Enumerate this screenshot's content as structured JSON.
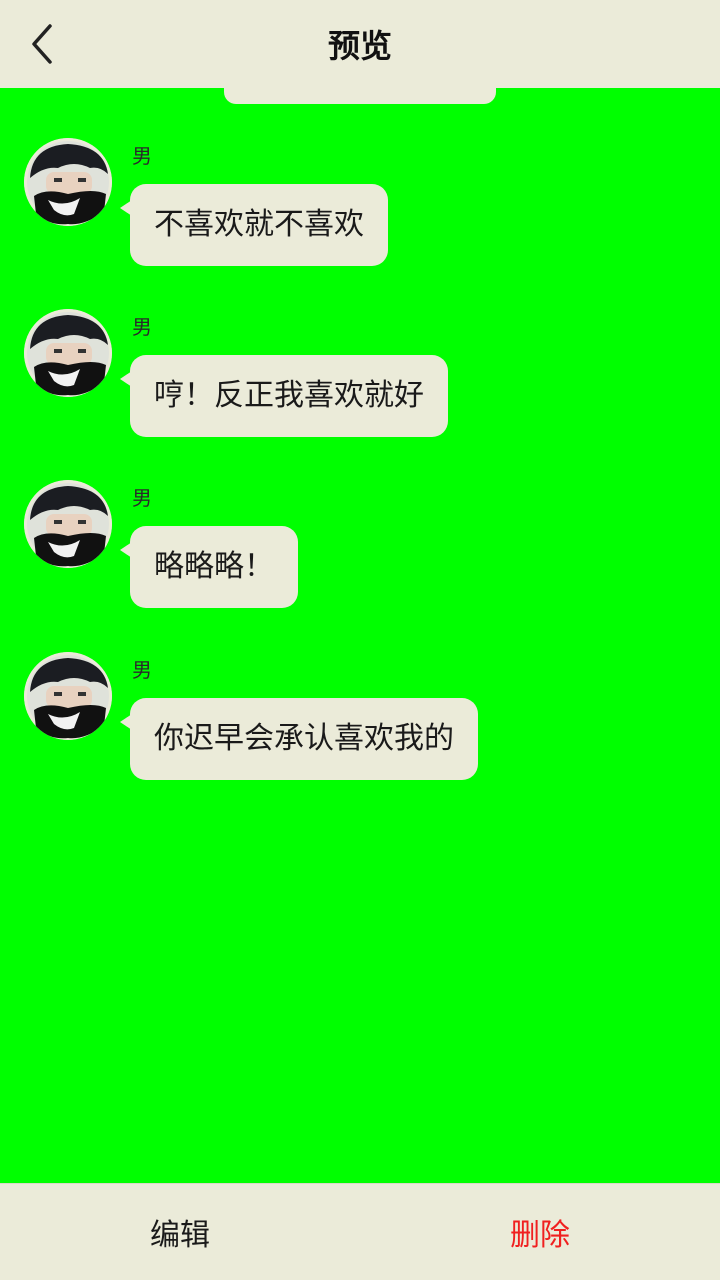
{
  "header": {
    "title": "预览",
    "back_icon": "chevron-left-icon"
  },
  "messages": [
    {
      "sender": "男",
      "text": "不喜欢就不喜欢"
    },
    {
      "sender": "男",
      "text": "哼！反正我喜欢就好"
    },
    {
      "sender": "男",
      "text": "略略略！"
    },
    {
      "sender": "男",
      "text": "你迟早会承认喜欢我的"
    }
  ],
  "bottom_bar": {
    "edit_label": "编辑",
    "delete_label": "删除"
  },
  "colors": {
    "background": "#00ff00",
    "bar": "#ebebd9",
    "bubble": "#ebebd9",
    "delete": "#f02020"
  }
}
